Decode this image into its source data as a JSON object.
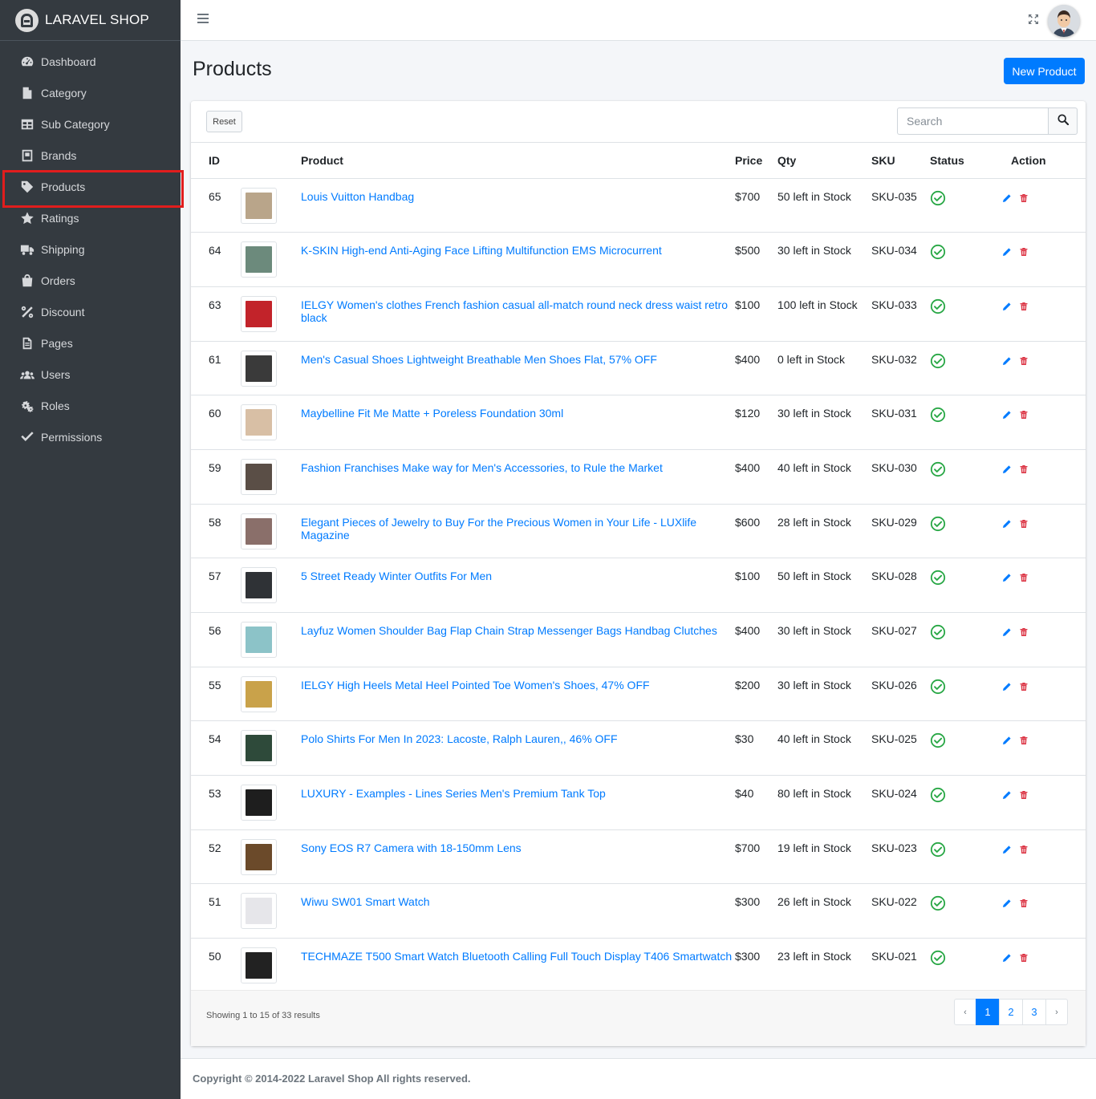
{
  "brand": {
    "name": "LARAVEL SHOP"
  },
  "sidebar": {
    "items": [
      {
        "label": "Dashboard",
        "icon": "dashboard-icon"
      },
      {
        "label": "Category",
        "icon": "file-icon"
      },
      {
        "label": "Sub Category",
        "icon": "table-icon"
      },
      {
        "label": "Brands",
        "icon": "book-icon"
      },
      {
        "label": "Products",
        "icon": "tag-icon",
        "active": true
      },
      {
        "label": "Ratings",
        "icon": "star-icon"
      },
      {
        "label": "Shipping",
        "icon": "truck-icon"
      },
      {
        "label": "Orders",
        "icon": "bag-icon"
      },
      {
        "label": "Discount",
        "icon": "percent-icon"
      },
      {
        "label": "Pages",
        "icon": "page-icon"
      },
      {
        "label": "Users",
        "icon": "users-icon"
      },
      {
        "label": "Roles",
        "icon": "cogs-icon"
      },
      {
        "label": "Permissions",
        "icon": "check-icon"
      }
    ]
  },
  "header": {
    "title": "Products",
    "new_button": "New Product"
  },
  "toolbar": {
    "reset_label": "Reset",
    "search_placeholder": "Search"
  },
  "table": {
    "columns": [
      "ID",
      "",
      "Product",
      "Price",
      "Qty",
      "SKU",
      "Status",
      "Action"
    ],
    "rows": [
      {
        "id": "65",
        "product": "Louis Vuitton Handbag",
        "price": "$700",
        "qty": "50 left in Stock",
        "sku": "SKU-035",
        "thumb": "#b9a58a"
      },
      {
        "id": "64",
        "product": "K-SKIN High-end Anti-Aging Face Lifting Multifunction EMS Microcurrent",
        "price": "$500",
        "qty": "30 left in Stock",
        "sku": "SKU-034",
        "thumb": "#6c8a7c"
      },
      {
        "id": "63",
        "product": "IELGY Women's clothes French fashion casual all-match round neck dress waist retro black",
        "price": "$100",
        "qty": "100 left in Stock",
        "sku": "SKU-033",
        "thumb": "#c2232a"
      },
      {
        "id": "61",
        "product": "Men's Casual Shoes Lightweight Breathable Men Shoes Flat, 57% OFF",
        "price": "$400",
        "qty": "0 left in Stock",
        "sku": "SKU-032",
        "thumb": "#3a3a3a"
      },
      {
        "id": "60",
        "product": "Maybelline Fit Me Matte + Poreless Foundation 30ml",
        "price": "$120",
        "qty": "30 left in Stock",
        "sku": "SKU-031",
        "thumb": "#d8bfa5"
      },
      {
        "id": "59",
        "product": "Fashion Franchises Make way for Men's Accessories, to Rule the Market",
        "price": "$400",
        "qty": "40 left in Stock",
        "sku": "SKU-030",
        "thumb": "#5a4e46"
      },
      {
        "id": "58",
        "product": "Elegant Pieces of Jewelry to Buy For the Precious Women in Your Life - LUXlife Magazine",
        "price": "$600",
        "qty": "28 left in Stock",
        "sku": "SKU-029",
        "thumb": "#8a6f6a"
      },
      {
        "id": "57",
        "product": "5 Street Ready Winter Outfits For Men",
        "price": "$100",
        "qty": "50 left in Stock",
        "sku": "SKU-028",
        "thumb": "#2f3236"
      },
      {
        "id": "56",
        "product": "Layfuz Women Shoulder Bag Flap Chain Strap Messenger Bags Handbag Clutches",
        "price": "$400",
        "qty": "30 left in Stock",
        "sku": "SKU-027",
        "thumb": "#8cc3c8"
      },
      {
        "id": "55",
        "product": "IELGY High Heels Metal Heel Pointed Toe Women's Shoes, 47% OFF",
        "price": "$200",
        "qty": "30 left in Stock",
        "sku": "SKU-026",
        "thumb": "#c9a24a"
      },
      {
        "id": "54",
        "product": "Polo Shirts For Men In 2023: Lacoste, Ralph Lauren,, 46% OFF",
        "price": "$30",
        "qty": "40 left in Stock",
        "sku": "SKU-025",
        "thumb": "#2e4a3a"
      },
      {
        "id": "53",
        "product": "LUXURY - Examples - Lines Series Men's Premium Tank Top",
        "price": "$40",
        "qty": "80 left in Stock",
        "sku": "SKU-024",
        "thumb": "#1e1e1e"
      },
      {
        "id": "52",
        "product": "Sony EOS R7 Camera with 18-150mm Lens",
        "price": "$700",
        "qty": "19 left in Stock",
        "sku": "SKU-023",
        "thumb": "#6b4a2a"
      },
      {
        "id": "51",
        "product": "Wiwu SW01 Smart Watch",
        "price": "$300",
        "qty": "26 left in Stock",
        "sku": "SKU-022",
        "thumb": "#e6e6ea"
      },
      {
        "id": "50",
        "product": "TECHMAZE T500 Smart Watch Bluetooth Calling Full Touch Display T406 Smartwatch",
        "price": "$300",
        "qty": "23 left in Stock",
        "sku": "SKU-021",
        "thumb": "#222222"
      }
    ]
  },
  "pagination": {
    "summary": "Showing 1 to 15 of 33 results",
    "prev": "‹",
    "pages": [
      "1",
      "2",
      "3"
    ],
    "next": "›",
    "current": "1"
  },
  "footer": {
    "copyright": "Copyright © 2014-2022 Laravel Shop All rights reserved."
  },
  "colors": {
    "sidebar": "#343a40",
    "accent": "#007bff",
    "success": "#28a745",
    "danger": "#dc3545",
    "highlight": "#e11d1d"
  }
}
